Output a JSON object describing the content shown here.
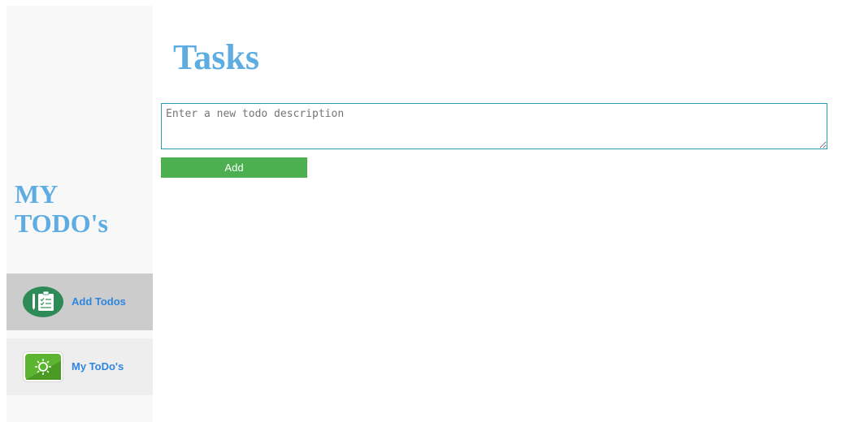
{
  "sidebar": {
    "brand": "MY TODO's",
    "items": [
      {
        "label": "Add Todos",
        "icon": "clipboard-pencil-icon",
        "active": true
      },
      {
        "label": "My ToDo's",
        "icon": "sun-icon",
        "active": false
      }
    ]
  },
  "main": {
    "title": "Tasks",
    "input_placeholder": "Enter a new todo description",
    "input_value": "",
    "add_label": "Add"
  },
  "colors": {
    "accent": "#5dade2",
    "link": "#2e86de",
    "button": "#4caf50",
    "active_nav": "#cccccc",
    "sidebar_bg": "#f8f8f8"
  }
}
